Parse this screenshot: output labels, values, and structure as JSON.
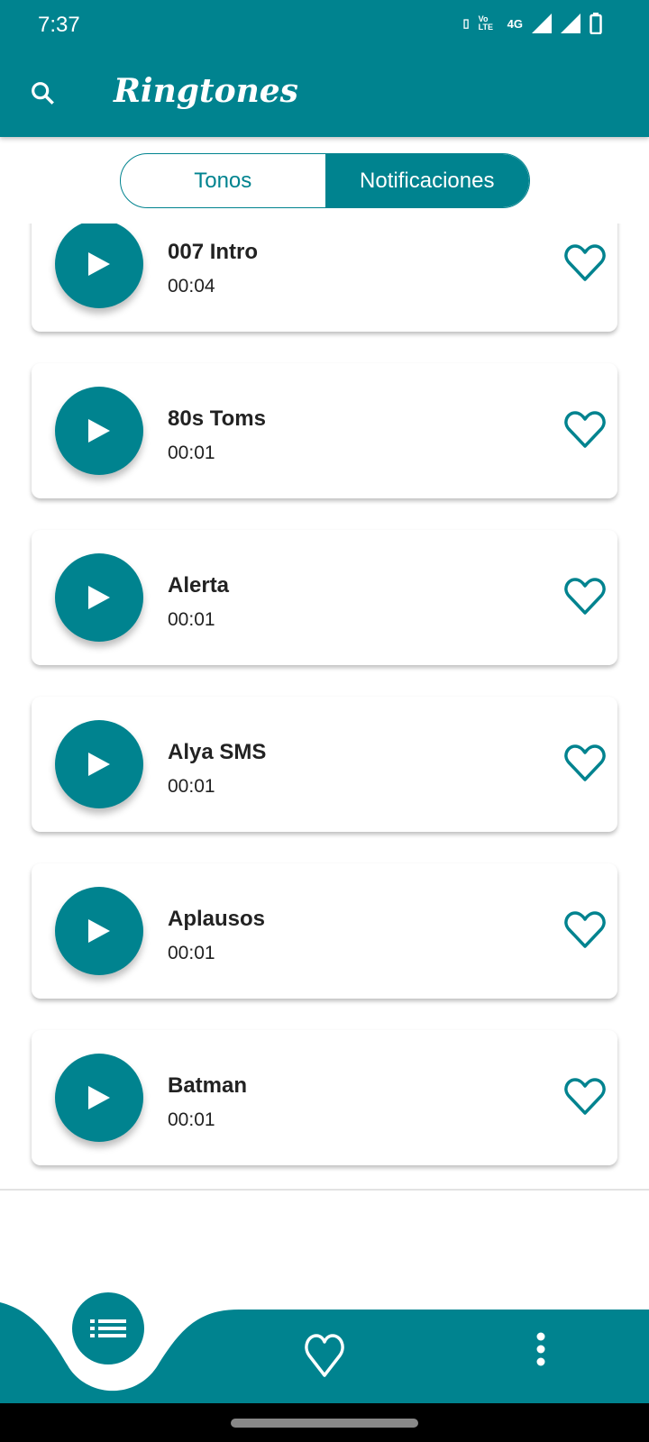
{
  "status_bar": {
    "time": "7:37",
    "network": "4G",
    "volte": "Vo LTE"
  },
  "header": {
    "title": "Ringtones"
  },
  "tabs": [
    {
      "label": "Tonos",
      "active": false
    },
    {
      "label": "Notificaciones",
      "active": true
    }
  ],
  "ringtones": [
    {
      "name": "007 Intro",
      "duration": "00:04"
    },
    {
      "name": "80s Toms",
      "duration": "00:01"
    },
    {
      "name": "Alerta",
      "duration": "00:01"
    },
    {
      "name": "Alya SMS",
      "duration": "00:01"
    },
    {
      "name": "Aplausos",
      "duration": "00:01"
    },
    {
      "name": "Batman",
      "duration": "00:01"
    }
  ],
  "bottom_nav": [
    "list-icon",
    "heart-icon",
    "more-vert-icon"
  ],
  "colors": {
    "primary": "#00838F"
  }
}
